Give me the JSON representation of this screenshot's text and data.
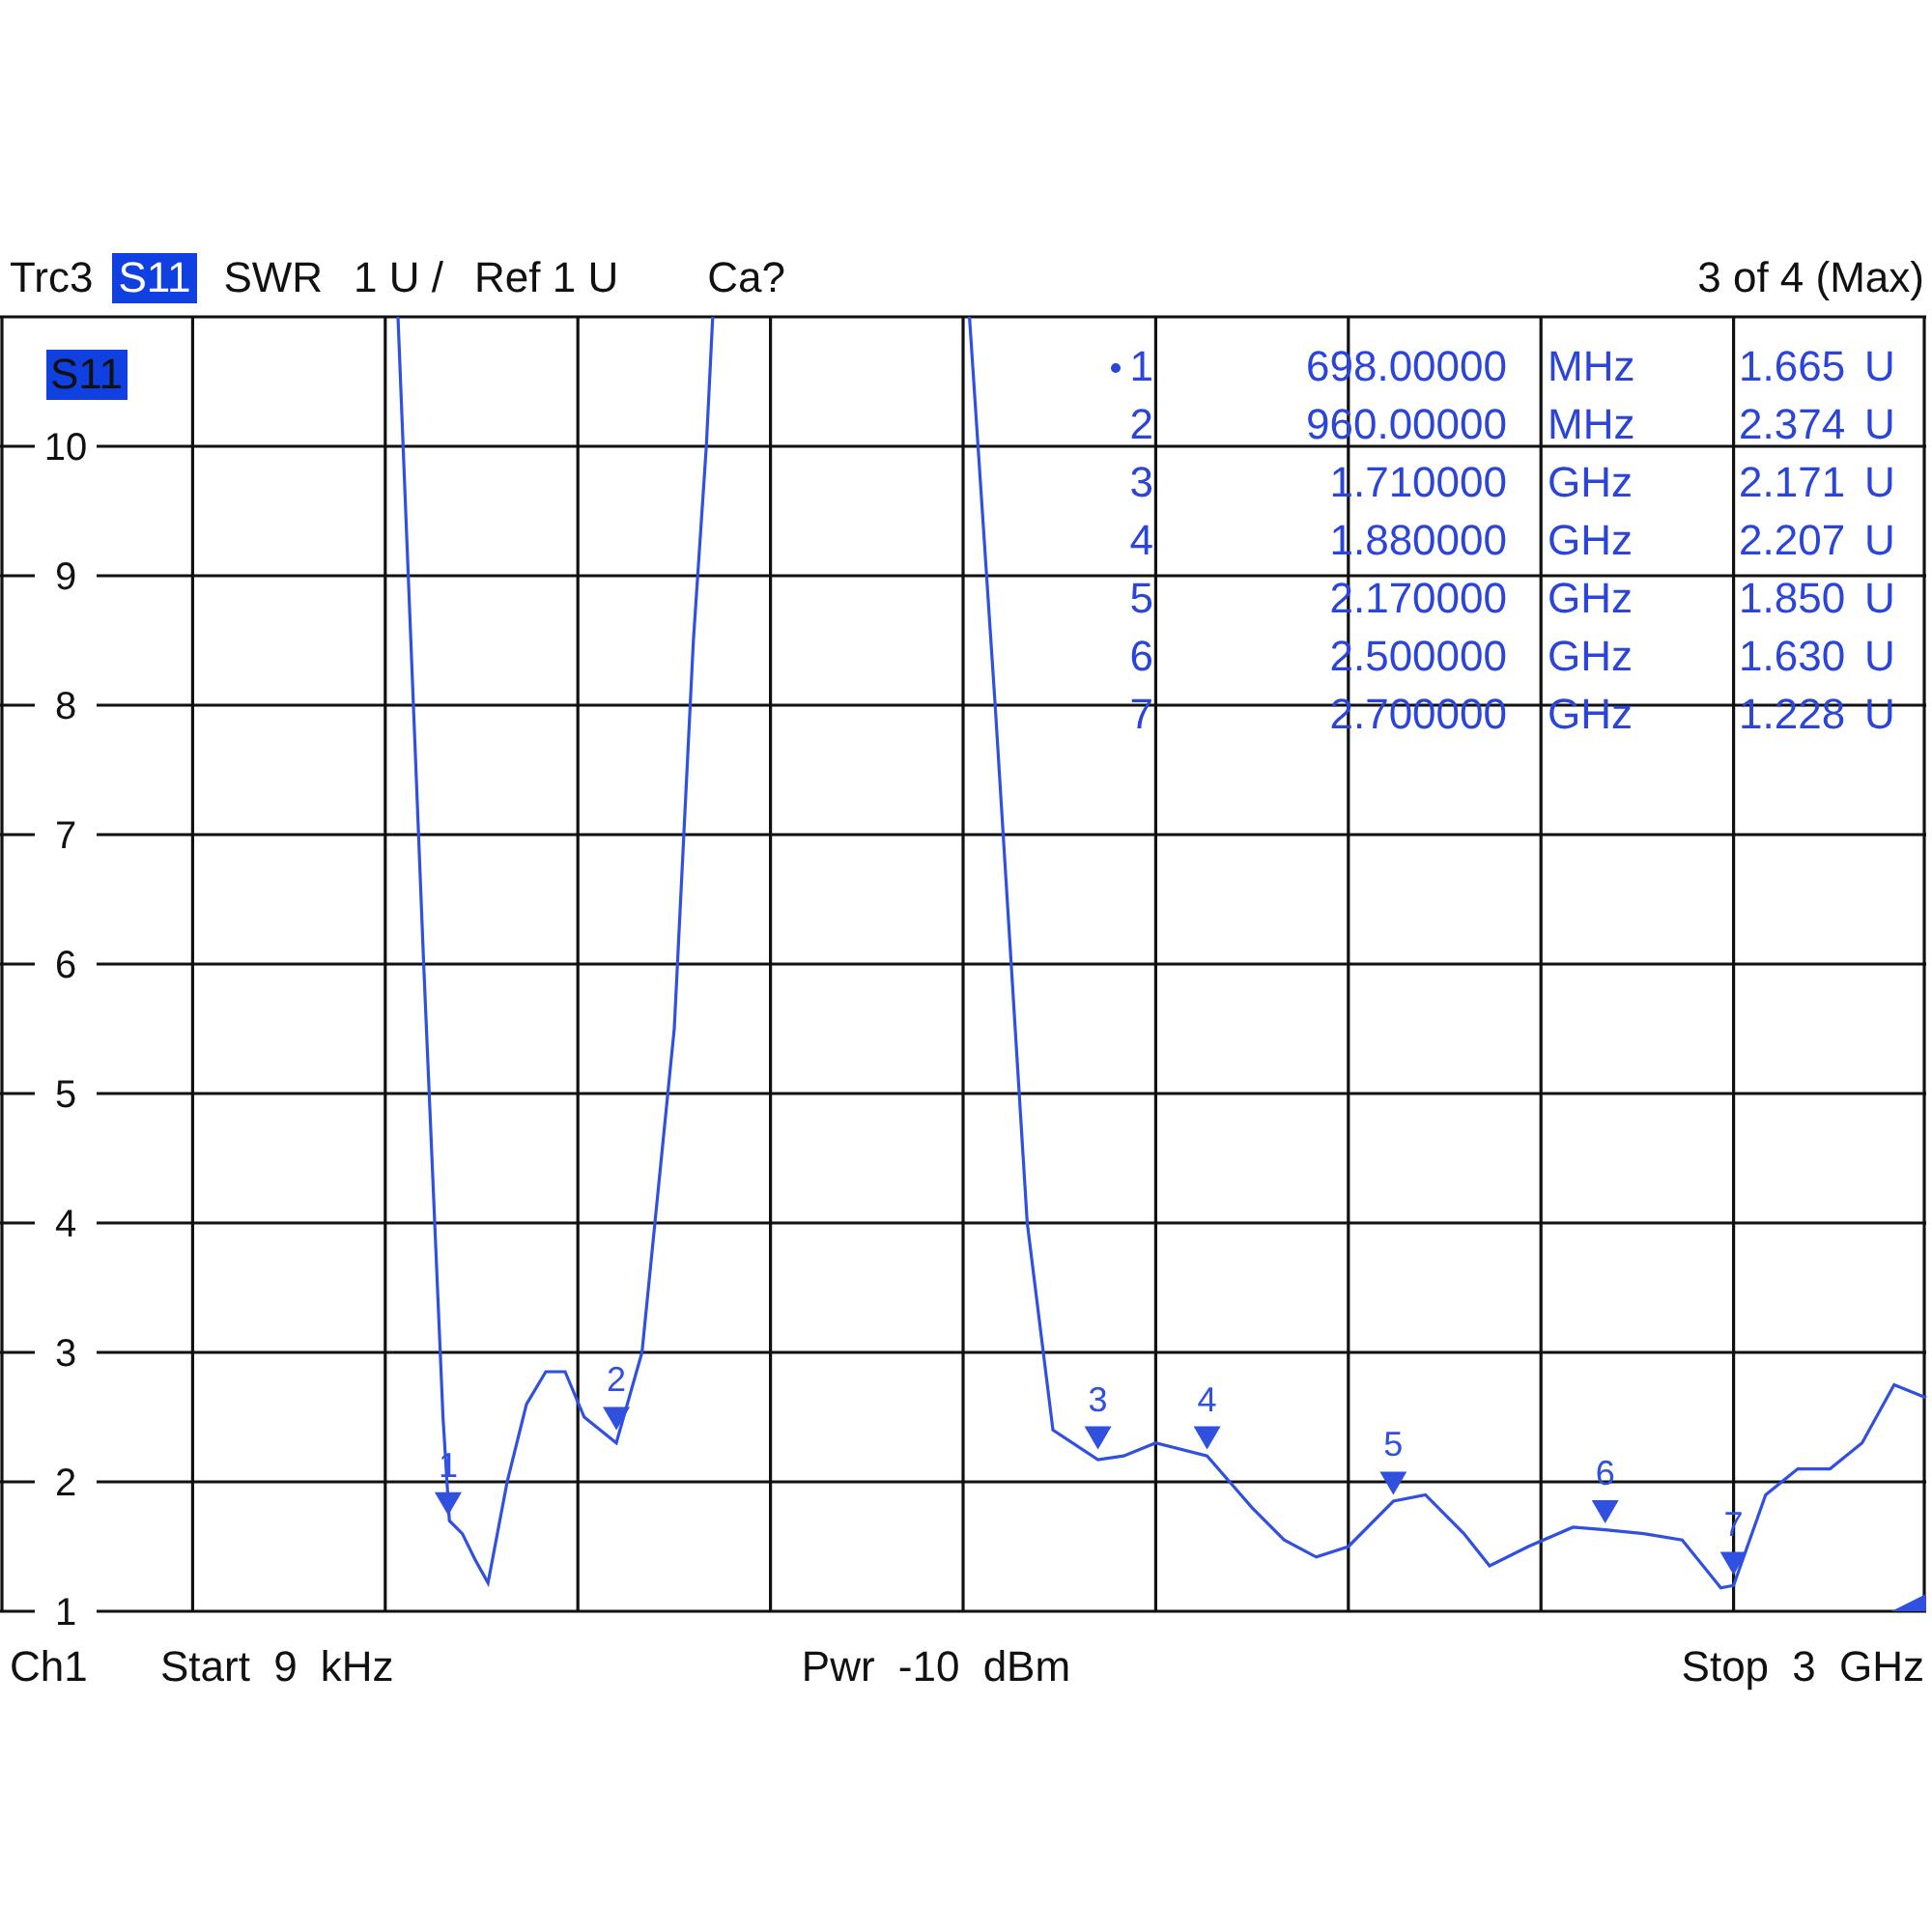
{
  "header": {
    "trace": "Trc3",
    "parameter": "S11",
    "format": "SWR",
    "scale": "1 U /",
    "reference": "Ref 1 U",
    "calibration": "Ca?",
    "trace_count": "3 of 4 (Max)"
  },
  "plot": {
    "trace_label": "S11",
    "y_axis_labels": [
      "10",
      "9",
      "8",
      "7",
      "6",
      "5",
      "4",
      "3",
      "2",
      "1"
    ],
    "trace_markers": [
      {
        "label": "1"
      },
      {
        "label": "2"
      },
      {
        "label": "3"
      },
      {
        "label": "4"
      },
      {
        "label": "5"
      },
      {
        "label": "6"
      },
      {
        "label": "7"
      }
    ],
    "markers": [
      {
        "number": "1",
        "active": true,
        "frequency": "698.00000",
        "unit": "MHz",
        "value": "1.665",
        "value_unit": "U"
      },
      {
        "number": "2",
        "active": false,
        "frequency": "960.00000",
        "unit": "MHz",
        "value": "2.374",
        "value_unit": "U"
      },
      {
        "number": "3",
        "active": false,
        "frequency": "1.710000",
        "unit": "GHz",
        "value": "2.171",
        "value_unit": "U"
      },
      {
        "number": "4",
        "active": false,
        "frequency": "1.880000",
        "unit": "GHz",
        "value": "2.207",
        "value_unit": "U"
      },
      {
        "number": "5",
        "active": false,
        "frequency": "2.170000",
        "unit": "GHz",
        "value": "1.850",
        "value_unit": "U"
      },
      {
        "number": "6",
        "active": false,
        "frequency": "2.500000",
        "unit": "GHz",
        "value": "1.630",
        "value_unit": "U"
      },
      {
        "number": "7",
        "active": false,
        "frequency": "2.700000",
        "unit": "GHz",
        "value": "1.228",
        "value_unit": "U"
      }
    ]
  },
  "footer": {
    "channel": "Ch1",
    "start": "Start 9 kHz",
    "power": "Pwr -10 dBm",
    "stop": "Stop 3 GHz"
  }
}
